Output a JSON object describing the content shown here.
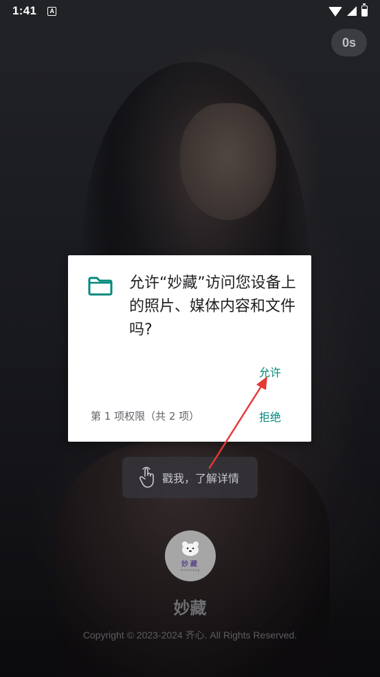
{
  "status_bar": {
    "time": "1:41",
    "notification_icon": "A"
  },
  "skip": {
    "countdown": "0s"
  },
  "dialog": {
    "icon": "folder-icon",
    "message": "允许“妙藏”访问您设备上的照片、媒体内容和文件吗?",
    "allow_label": "允许",
    "deny_label": "拒绝",
    "permission_count": "第 1 项权限（共 2 项）"
  },
  "detail_pill": {
    "label": "戳我，了解详情"
  },
  "logo": {
    "text": "妙藏",
    "subtext": "miaocang"
  },
  "app": {
    "name": "妙藏",
    "copyright": "Copyright © 2023-2024 齐心. All Rights Reserved."
  },
  "colors": {
    "accent": "#00897b",
    "arrow": "#e53935"
  }
}
